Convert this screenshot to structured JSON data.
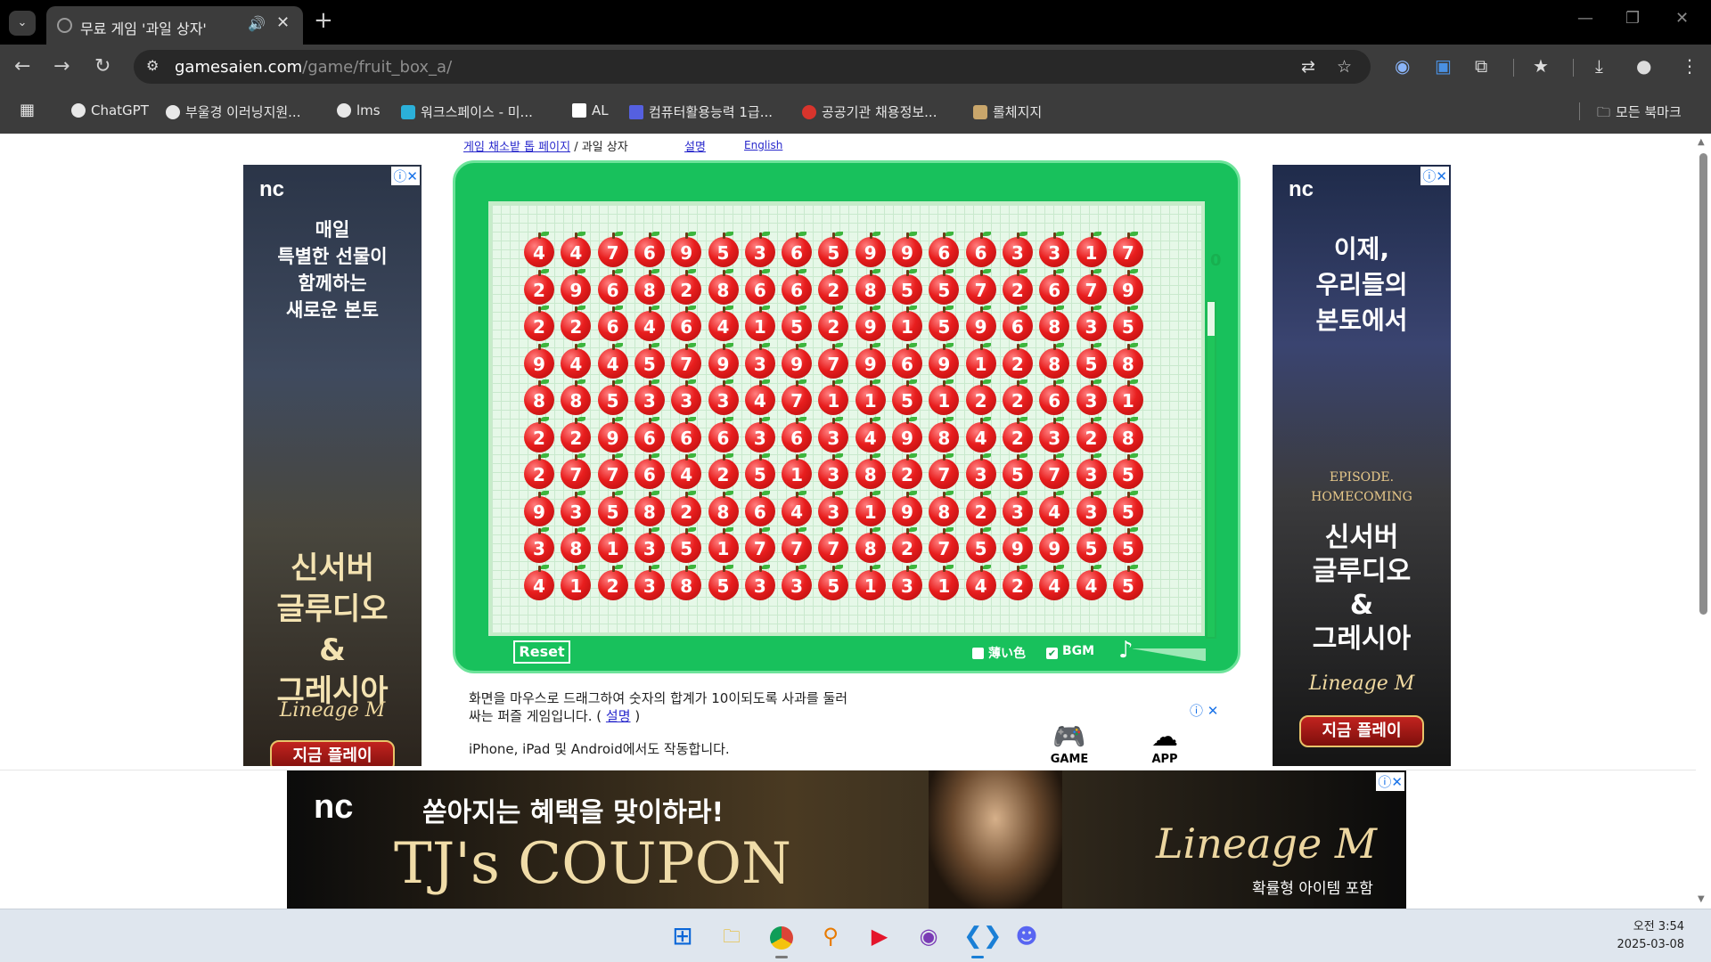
{
  "browser": {
    "tab_title": "무료 게임 '과일 상자'",
    "url_host": "gamesaien.com",
    "url_path": "/game/fruit_box_a/",
    "bookmarks": [
      "ChatGPT",
      "부울경 이러닝지원...",
      "lms",
      "워크스페이스 - 미...",
      "AL",
      "컴퓨터활용능력 1급...",
      "공공기관 채용정보...",
      "롤체지지"
    ],
    "all_bookmarks": "모든 북마크"
  },
  "page": {
    "breadcrumb_link": "게임 채소밭 톱 페이지",
    "breadcrumb_sep": "/",
    "breadcrumb_current": "과일 상자",
    "help_link": "설명",
    "english_link": "English"
  },
  "game": {
    "score": "0",
    "timer_level": 0.9,
    "grid": [
      [
        4,
        4,
        7,
        6,
        9,
        5,
        3,
        6,
        5,
        9,
        9,
        6,
        6,
        3,
        3,
        1,
        7
      ],
      [
        2,
        9,
        6,
        8,
        2,
        8,
        6,
        6,
        2,
        8,
        5,
        5,
        7,
        2,
        6,
        7,
        9
      ],
      [
        2,
        2,
        6,
        4,
        6,
        4,
        1,
        5,
        2,
        9,
        1,
        5,
        9,
        6,
        8,
        3,
        5
      ],
      [
        9,
        4,
        4,
        5,
        7,
        9,
        3,
        9,
        7,
        9,
        6,
        9,
        1,
        2,
        8,
        5,
        8
      ],
      [
        8,
        8,
        5,
        3,
        3,
        3,
        4,
        7,
        1,
        1,
        5,
        1,
        2,
        2,
        6,
        3,
        1
      ],
      [
        2,
        2,
        9,
        6,
        6,
        6,
        3,
        6,
        3,
        4,
        9,
        8,
        4,
        2,
        3,
        2,
        8
      ],
      [
        2,
        7,
        7,
        6,
        4,
        2,
        5,
        1,
        3,
        8,
        2,
        7,
        3,
        5,
        7,
        3,
        5
      ],
      [
        9,
        3,
        5,
        8,
        2,
        8,
        6,
        4,
        3,
        1,
        9,
        8,
        2,
        3,
        4,
        3,
        5
      ],
      [
        3,
        8,
        1,
        3,
        5,
        1,
        7,
        7,
        7,
        8,
        2,
        7,
        5,
        9,
        9,
        5,
        5
      ],
      [
        4,
        1,
        2,
        3,
        8,
        5,
        3,
        3,
        5,
        1,
        3,
        1,
        4,
        2,
        4,
        4,
        5
      ]
    ],
    "reset_label": "Reset",
    "light_color_label": "薄い色",
    "bgm_label": "BGM",
    "bgm_checked": true
  },
  "description": {
    "line1": "화면을 마우스로 드래그하여 숫자의 합계가 10이되도록 사과를 둘러",
    "line2_prefix": "싸는 퍼즐 게임입니다. (",
    "line2_link": "설명",
    "line2_suffix": ")",
    "platforms": "iPhone, iPad 및 Android에서도 작동합니다.",
    "game_btn": "GAME",
    "app_btn": "APP"
  },
  "ads": {
    "left_top": "매일\n특별한 선물이\n함께하는\n새로운 본토",
    "left_mid": "신서버\n글루디오\n&\n그레시아",
    "left_brand": "Lineage M",
    "left_play": "지금 플레이",
    "right_top": "이제,\n우리들의\n본토에서",
    "right_episode": "EPISODE.\nHOMECOMING",
    "right_mid": "신서버\n글루디오\n&\n그레시아",
    "right_brand": "Lineage M",
    "right_play": "지금 플레이",
    "nc": "nc",
    "banner_headline": "쏟아지는 혜택을 맞이하라!",
    "banner_coupon": "TJ's COUPON",
    "banner_brand": "Lineage M",
    "banner_note": "확률형 아이템 포함"
  },
  "taskbar": {
    "time": "오전 3:54",
    "date": "2025-03-08"
  }
}
